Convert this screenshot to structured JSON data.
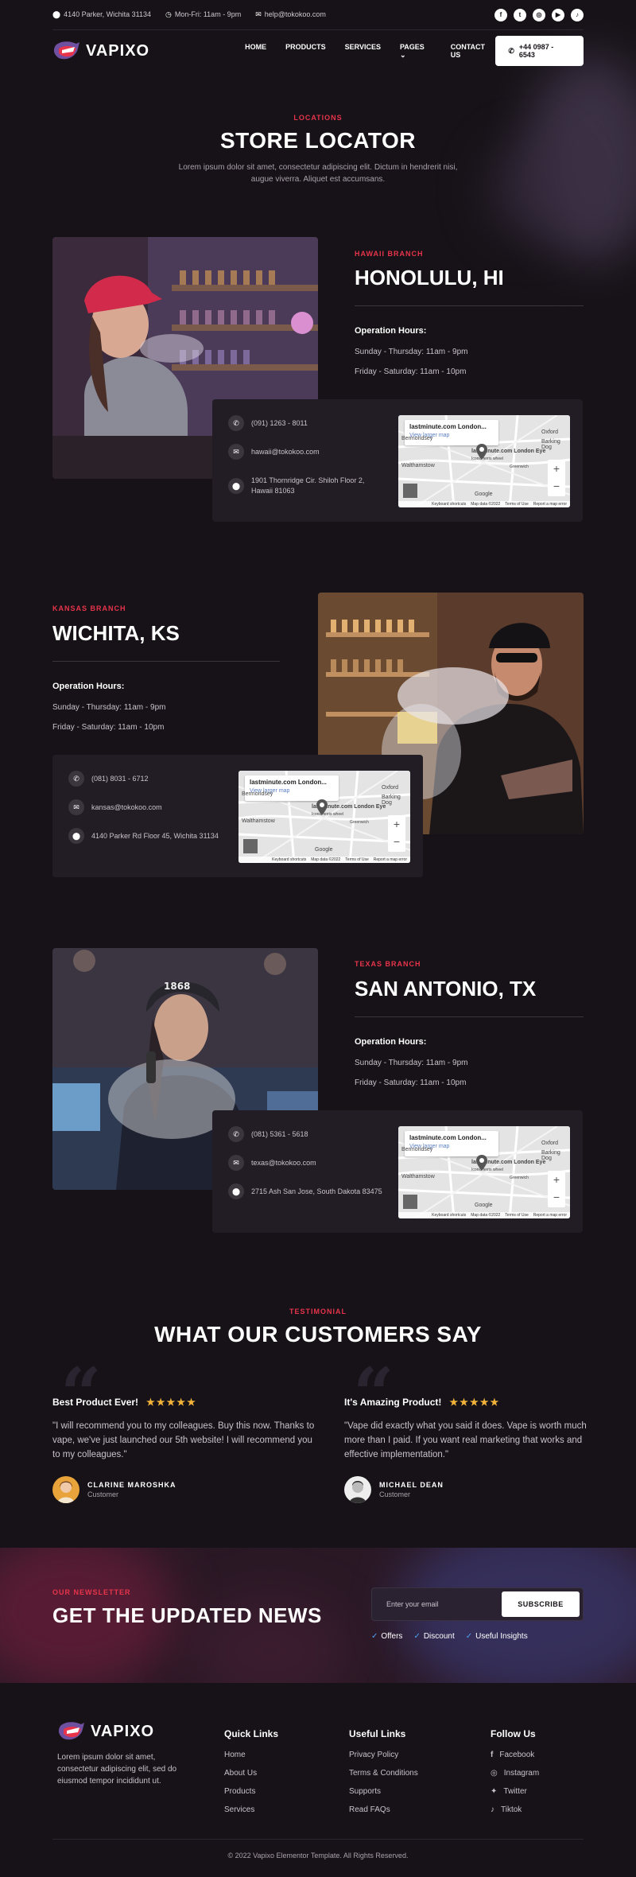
{
  "topbar": {
    "address": "4140 Parker, Wichita 31134",
    "hours": "Mon-Fri: 11am - 9pm",
    "email": "help@tokokoo.com",
    "socials": [
      "facebook-icon",
      "twitter-icon",
      "instagram-icon",
      "youtube-icon",
      "tiktok-icon"
    ]
  },
  "header": {
    "logo": "VAPIXO",
    "nav": [
      "HOME",
      "PRODUCTS",
      "SERVICES",
      "PAGES",
      "CONTACT US"
    ],
    "phone": "+44 0987 - 6543"
  },
  "intro": {
    "eyebrow": "LOCATIONS",
    "title": "STORE LOCATOR",
    "text": "Lorem ipsum dolor sit amet, consectetur adipiscing elit. Dictum in hendrerit nisi, augue viverra. Aliquet est accumsans."
  },
  "branches": [
    {
      "tag": "HAWAII BRANCH",
      "name": "HONOLULU, HI",
      "op_title": "Operation Hours:",
      "hours1": "Sunday - Thursday: 11am - 9pm",
      "hours2": "Friday - Saturday: 11am - 10pm",
      "phone": "(091) 1263 - 8011",
      "email": "hawaii@tokokoo.com",
      "address": "1901 Thornridge Cir. Shiloh Floor 2, Hawaii 81063"
    },
    {
      "tag": "KANSAS BRANCH",
      "name": "WICHITA, KS",
      "op_title": "Operation Hours:",
      "hours1": "Sunday - Thursday: 11am - 9pm",
      "hours2": "Friday - Saturday: 11am - 10pm",
      "phone": "(081) 8031 - 6712",
      "email": "kansas@tokokoo.com",
      "address": "4140 Parker Rd Floor 45, Wichita 31134"
    },
    {
      "tag": "TEXAS BRANCH",
      "name": "SAN ANTONIO, TX",
      "op_title": "Operation Hours:",
      "hours1": "Sunday - Thursday: 11am - 9pm",
      "hours2": "Friday - Saturday: 11am - 10pm",
      "phone": "(081) 5361 - 5618",
      "email": "texas@tokokoo.com",
      "address": "2715 Ash San Jose, South Dakota 83475"
    }
  ],
  "map": {
    "title": "lastminute.com London...",
    "link": "View larger map",
    "place": "lastminute.com London Eye",
    "place_sub": "Iconic ferris wheel",
    "labels": [
      "Bermondsey",
      "Oxford",
      "Barking Dog",
      "Walthamstow",
      "Greenwich",
      "Google"
    ],
    "footer": [
      "Keyboard shortcuts",
      "Map data ©2022",
      "Terms of Use",
      "Report a map error"
    ]
  },
  "testimonials": {
    "eyebrow": "TESTIMONIAL",
    "title": "WHAT OUR CUSTOMERS SAY",
    "items": [
      {
        "title": "Best Product Ever!",
        "stars": "★★★★★",
        "text": "\"I will recommend you to my colleagues. Buy this now. Thanks to vape, we've just launched our 5th website! I will recommend you to my colleagues.\"",
        "name": "CLARINE MAROSHKA",
        "role": "Customer"
      },
      {
        "title": "It's Amazing Product!",
        "stars": "★★★★★",
        "text": "\"Vape did exactly what you said it does. Vape is worth much more than I paid. If you want real marketing that works and effective implementation.\"",
        "name": "MICHAEL DEAN",
        "role": "Customer"
      }
    ]
  },
  "newsletter": {
    "eyebrow": "OUR NEWSLETTER",
    "title": "GET THE UPDATED NEWS",
    "placeholder": "Enter your email",
    "button": "SUBSCRIBE",
    "checks": [
      "Offers",
      "Discount",
      "Useful Insights"
    ]
  },
  "footer": {
    "logo": "VAPIXO",
    "about": "Lorem ipsum dolor sit amet, consectetur adipiscing elit, sed do eiusmod tempor incididunt ut.",
    "quick_title": "Quick Links",
    "quick": [
      "Home",
      "About Us",
      "Products",
      "Services"
    ],
    "useful_title": "Useful Links",
    "useful": [
      "Privacy Policy",
      "Terms & Conditions",
      "Supports",
      "Read FAQs"
    ],
    "follow_title": "Follow Us",
    "follow": [
      "Facebook",
      "Instagram",
      "Twitter",
      "Tiktok"
    ],
    "copyright": "© 2022 Vapixo Elementor Template. All Rights Reserved."
  },
  "colors": {
    "accent": "#e8344b",
    "background": "#161217",
    "card": "#221d24",
    "star": "#f4b43a",
    "check": "#4ba3f5"
  }
}
